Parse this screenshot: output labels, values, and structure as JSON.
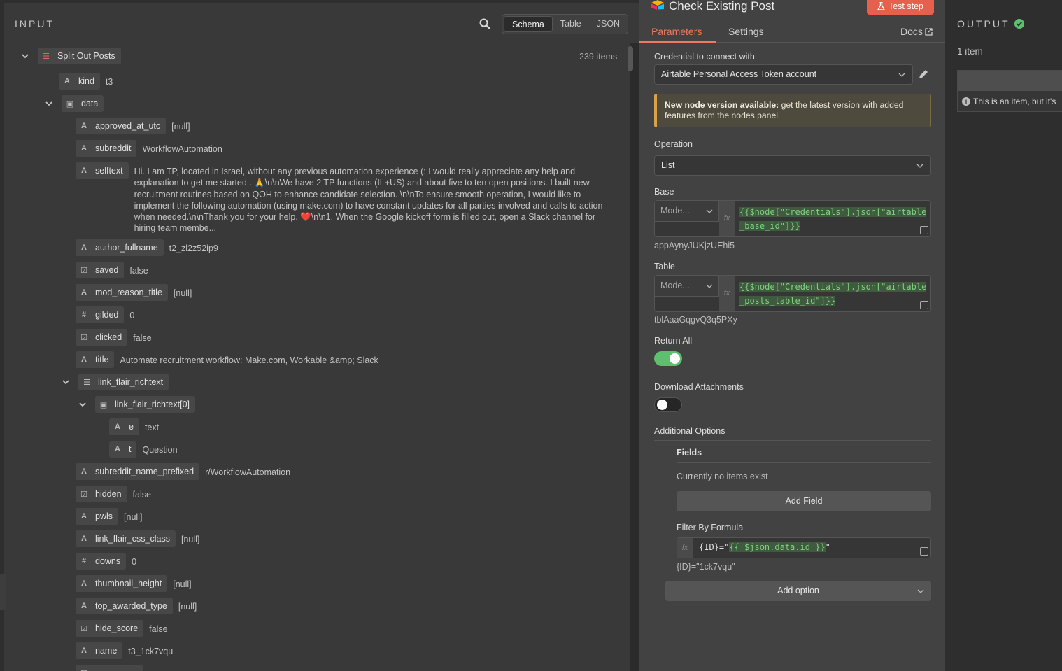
{
  "input": {
    "title": "INPUT",
    "views": [
      "Schema",
      "Table",
      "JSON"
    ],
    "active_view": "Schema",
    "root": {
      "label": "Split Out Posts",
      "count": "239 items"
    },
    "rows": {
      "kind": {
        "key": "kind",
        "type": "A",
        "value": "t3"
      },
      "data": {
        "key": "data",
        "type": "obj"
      },
      "approved_at_utc": {
        "key": "approved_at_utc",
        "type": "A",
        "value": "[null]"
      },
      "subreddit": {
        "key": "subreddit",
        "type": "A",
        "value": "WorkflowAutomation"
      },
      "selftext": {
        "key": "selftext",
        "type": "A",
        "value": "Hi. I am TP, located in Israel, without any previous automation experience (: I would really appreciate any help and explanation to get me started . 🙏\\n\\nWe have 2 TP functions (IL+US) and about five to ten open positions. I built new recruitment routines based on QOH to enhance candidate selection. \\n\\nTo ensure smooth operation, I would like to implement the following automation (using make.com) to have constant updates for all parties involved and calls to action when needed.\\n\\nThank you for your help. ❤️\\n\\n1. When the Google kickoff form is filled out, open a Slack channel for hiring team membe..."
      },
      "author_fullname": {
        "key": "author_fullname",
        "type": "A",
        "value": "t2_zl2z52ip9"
      },
      "saved": {
        "key": "saved",
        "type": "bool",
        "value": "false"
      },
      "mod_reason_title": {
        "key": "mod_reason_title",
        "type": "A",
        "value": "[null]"
      },
      "gilded": {
        "key": "gilded",
        "type": "#",
        "value": "0"
      },
      "clicked": {
        "key": "clicked",
        "type": "bool",
        "value": "false"
      },
      "title": {
        "key": "title",
        "type": "A",
        "value": "Automate recruitment workflow: Make.com, Workable &amp; Slack"
      },
      "link_flair_richtext": {
        "key": "link_flair_richtext",
        "type": "list"
      },
      "link_flair_richtext0": {
        "key": "link_flair_richtext[0]",
        "type": "obj"
      },
      "e": {
        "key": "e",
        "type": "A",
        "value": "text"
      },
      "t": {
        "key": "t",
        "type": "A",
        "value": "Question"
      },
      "subreddit_name_prefixed": {
        "key": "subreddit_name_prefixed",
        "type": "A",
        "value": "r/WorkflowAutomation"
      },
      "hidden": {
        "key": "hidden",
        "type": "bool",
        "value": "false"
      },
      "pwls": {
        "key": "pwls",
        "type": "A",
        "value": "[null]"
      },
      "link_flair_css_class": {
        "key": "link_flair_css_class",
        "type": "A",
        "value": "[null]"
      },
      "downs": {
        "key": "downs",
        "type": "#",
        "value": "0"
      },
      "thumbnail_height": {
        "key": "thumbnail_height",
        "type": "A",
        "value": "[null]"
      },
      "top_awarded_type": {
        "key": "top_awarded_type",
        "type": "A",
        "value": "[null]"
      },
      "hide_score": {
        "key": "hide_score",
        "type": "bool",
        "value": "false"
      },
      "name": {
        "key": "name",
        "type": "A",
        "value": "t3_1ck7vqu"
      }
    }
  },
  "node": {
    "title": "Check Existing Post",
    "test_label": "Test step",
    "tabs": {
      "parameters": "Parameters",
      "settings": "Settings",
      "docs": "Docs"
    },
    "credential_label": "Credential to connect with",
    "credential_value": "Airtable Personal Access Token account",
    "notice_bold": "New node version available:",
    "notice_text": " get the latest version with added features from the nodes panel.",
    "operation_label": "Operation",
    "operation_value": "List",
    "base_label": "Base",
    "base_mode": "Mode...",
    "base_expr": "{{$node[\"Credentials\"].json[\"airtable_base_id\"]}}",
    "base_hint": "appAynyJUKjzUEhi5",
    "table_label": "Table",
    "table_mode": "Mode...",
    "table_expr": "{{$node[\"Credentials\"].json[\"airtable_posts_table_id\"]}}",
    "table_hint": "tblAaaGqgvQ3q5PXy",
    "return_all_label": "Return All",
    "return_all": true,
    "download_label": "Download Attachments",
    "download": false,
    "additional_label": "Additional Options",
    "fields_label": "Fields",
    "no_items": "Currently no items exist",
    "add_field": "Add Field",
    "filter_label": "Filter By Formula",
    "filter_prefix": "{ID}=\"",
    "filter_expr": "{{ $json.data.id }}",
    "filter_suffix": "\"",
    "filter_hint": "{ID}=\"1ck7vqu\"",
    "add_option": "Add option",
    "fx": "fx"
  },
  "output": {
    "title": "OUTPUT",
    "count": "1 item",
    "message": "This is an item, but it's"
  },
  "colors": {
    "accent": "#ec7b5b",
    "test_button": "#e5604d",
    "toggle_on": "#5cc06e",
    "expression_green": "#7fd17f",
    "notice_border": "#d8a24a"
  }
}
